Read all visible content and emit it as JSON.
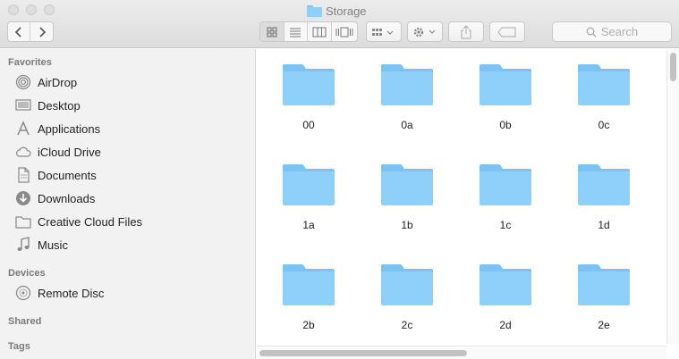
{
  "window": {
    "title": "Storage"
  },
  "toolbar": {
    "back_icon": "chevron-left-icon",
    "forward_icon": "chevron-right-icon",
    "views": [
      "icon-view",
      "list-view",
      "column-view",
      "cover-flow-view"
    ],
    "active_view": "icon-view",
    "search_placeholder": "Search"
  },
  "sidebar": {
    "favorites_label": "Favorites",
    "favorites": [
      {
        "label": "AirDrop",
        "icon": "airdrop-icon"
      },
      {
        "label": "Desktop",
        "icon": "desktop-icon"
      },
      {
        "label": "Applications",
        "icon": "applications-icon"
      },
      {
        "label": "iCloud Drive",
        "icon": "cloud-icon"
      },
      {
        "label": "Documents",
        "icon": "documents-icon"
      },
      {
        "label": "Downloads",
        "icon": "downloads-icon"
      },
      {
        "label": "Creative Cloud Files",
        "icon": "folder-icon"
      },
      {
        "label": "Music",
        "icon": "music-icon"
      }
    ],
    "devices_label": "Devices",
    "devices": [
      {
        "label": "Remote Disc",
        "icon": "disc-icon"
      }
    ],
    "shared_label": "Shared",
    "tags_label": "Tags"
  },
  "folders": [
    "00",
    "0a",
    "0b",
    "0c",
    "1a",
    "1b",
    "1c",
    "1d",
    "2b",
    "2c",
    "2d",
    "2e"
  ],
  "colors": {
    "folder": "#8fd0fb",
    "folder_tab": "#7cc3f4",
    "sidebar_bg": "#f2f2f2"
  }
}
